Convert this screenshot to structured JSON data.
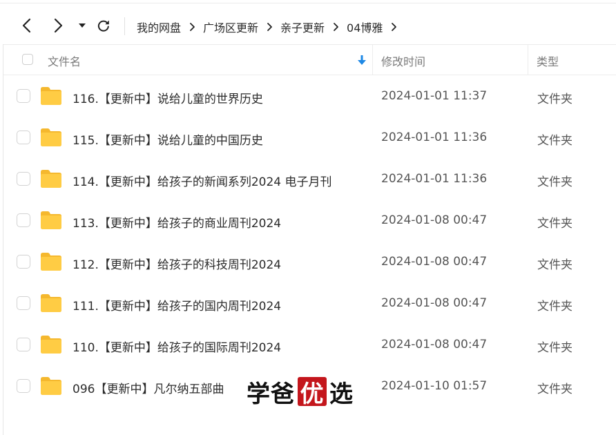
{
  "breadcrumb": [
    {
      "label": "我的网盘"
    },
    {
      "label": "广场区更新"
    },
    {
      "label": "亲子更新"
    },
    {
      "label": "04博雅"
    }
  ],
  "columns": {
    "name": "文件名",
    "modified": "修改时间",
    "type": "类型"
  },
  "rows": [
    {
      "name": "116.【更新中】说给儿童的世界历史",
      "modified": "2024-01-01 11:37",
      "type": "文件夹"
    },
    {
      "name": "115.【更新中】说给儿童的中国历史",
      "modified": "2024-01-01 11:36",
      "type": "文件夹"
    },
    {
      "name": "114.【更新中】给孩子的新闻系列2024 电子月刊",
      "modified": "2024-01-01 11:36",
      "type": "文件夹"
    },
    {
      "name": "113.【更新中】给孩子的商业周刊2024",
      "modified": "2024-01-08 00:47",
      "type": "文件夹"
    },
    {
      "name": "112.【更新中】给孩子的科技周刊2024",
      "modified": "2024-01-08 00:47",
      "type": "文件夹"
    },
    {
      "name": "111.【更新中】给孩子的国内周刊2024",
      "modified": "2024-01-08 00:47",
      "type": "文件夹"
    },
    {
      "name": "110.【更新中】给孩子的国际周刊2024",
      "modified": "2024-01-08 00:47",
      "type": "文件夹"
    },
    {
      "name": "096【更新中】凡尔纳五部曲",
      "modified": "2024-01-10 01:57",
      "type": "文件夹"
    }
  ],
  "watermark": {
    "part1": "学爸",
    "seal": "优",
    "part2": "选"
  },
  "icons": {
    "back": "chevron-left-icon",
    "forward": "chevron-right-icon",
    "history": "caret-down-icon",
    "refresh": "refresh-icon",
    "sort": "sort-arrow-down-icon",
    "folder": "folder-icon"
  },
  "colors": {
    "folder": "#FFC53D",
    "accent": "#1E88E5",
    "seal": "#C4161C"
  }
}
